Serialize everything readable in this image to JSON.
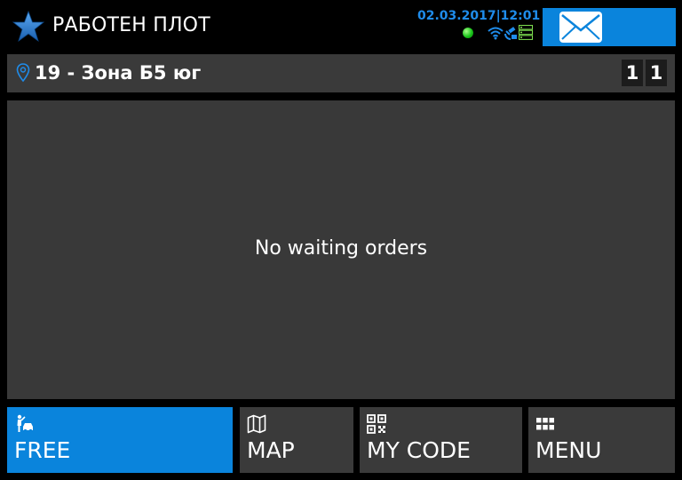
{
  "header": {
    "title": "РАБОТЕН ПЛОТ",
    "datetime": "02.03.2017|12:01",
    "logo_icon": "star-icon",
    "status_icons": [
      "connection-dot-icon",
      "wifi-icon",
      "gps-icon",
      "server-icon"
    ],
    "status_dot_color": "#19c41a",
    "accent_color": "#1f8cea"
  },
  "messages_button": {
    "icon": "envelope-icon",
    "color": "#0a84dc"
  },
  "zone": {
    "label": "19 - Зона Б5 юг",
    "counter_a": "1",
    "counter_b": "1"
  },
  "orders": {
    "empty_message": "No waiting orders"
  },
  "nav": {
    "free": {
      "label": "FREE",
      "icon": "driver-car-icon",
      "active": true
    },
    "map": {
      "label": "MAP",
      "icon": "map-icon"
    },
    "code": {
      "label": "MY CODE",
      "icon": "qr-code-icon"
    },
    "menu": {
      "label": "MENU",
      "icon": "grid-menu-icon"
    }
  }
}
